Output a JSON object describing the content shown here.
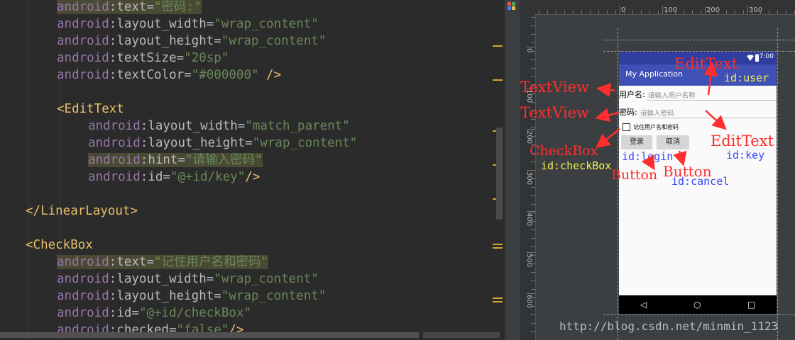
{
  "code_lines": [
    {
      "segments": [
        {
          "t": "android",
          "c": "ns hl"
        },
        {
          "t": ":",
          "c": "pun hl"
        },
        {
          "t": "text",
          "c": "attr hl"
        },
        {
          "t": "=",
          "c": "pun hl"
        },
        {
          "t": "\"密码:\"",
          "c": "str hl"
        }
      ],
      "indent": 80
    },
    {
      "segments": [
        {
          "t": "android",
          "c": "ns"
        },
        {
          "t": ":",
          "c": "pun"
        },
        {
          "t": "layout_width",
          "c": "attr"
        },
        {
          "t": "=",
          "c": "pun"
        },
        {
          "t": "\"wrap_content\"",
          "c": "str"
        }
      ],
      "indent": 80
    },
    {
      "segments": [
        {
          "t": "android",
          "c": "ns"
        },
        {
          "t": ":",
          "c": "pun"
        },
        {
          "t": "layout_height",
          "c": "attr"
        },
        {
          "t": "=",
          "c": "pun"
        },
        {
          "t": "\"wrap_content\"",
          "c": "str"
        }
      ],
      "indent": 80
    },
    {
      "segments": [
        {
          "t": "android",
          "c": "ns"
        },
        {
          "t": ":",
          "c": "pun"
        },
        {
          "t": "textSize",
          "c": "attr"
        },
        {
          "t": "=",
          "c": "pun"
        },
        {
          "t": "\"20sp\"",
          "c": "str"
        }
      ],
      "indent": 80
    },
    {
      "segments": [
        {
          "t": "android",
          "c": "ns"
        },
        {
          "t": ":",
          "c": "pun"
        },
        {
          "t": "textColor",
          "c": "attr"
        },
        {
          "t": "=",
          "c": "pun"
        },
        {
          "t": "\"#000000\"",
          "c": "str"
        },
        {
          "t": " />",
          "c": "tag"
        }
      ],
      "indent": 80
    },
    {
      "segments": [],
      "indent": 0
    },
    {
      "segments": [
        {
          "t": "<EditText",
          "c": "tag"
        }
      ],
      "indent": 80
    },
    {
      "segments": [
        {
          "t": "android",
          "c": "ns"
        },
        {
          "t": ":",
          "c": "pun"
        },
        {
          "t": "layout_width",
          "c": "attr"
        },
        {
          "t": "=",
          "c": "pun"
        },
        {
          "t": "\"match_parent\"",
          "c": "str"
        }
      ],
      "indent": 124
    },
    {
      "segments": [
        {
          "t": "android",
          "c": "ns"
        },
        {
          "t": ":",
          "c": "pun"
        },
        {
          "t": "layout_height",
          "c": "attr"
        },
        {
          "t": "=",
          "c": "pun"
        },
        {
          "t": "\"wrap_content\"",
          "c": "str"
        }
      ],
      "indent": 124
    },
    {
      "segments": [
        {
          "t": "android",
          "c": "ns hl"
        },
        {
          "t": ":",
          "c": "pun hl"
        },
        {
          "t": "hint",
          "c": "attr hl"
        },
        {
          "t": "=",
          "c": "pun hl"
        },
        {
          "t": "\"请输入密码\"",
          "c": "str hl"
        }
      ],
      "indent": 124
    },
    {
      "segments": [
        {
          "t": "android",
          "c": "ns"
        },
        {
          "t": ":",
          "c": "pun"
        },
        {
          "t": "id",
          "c": "attr"
        },
        {
          "t": "=",
          "c": "pun"
        },
        {
          "t": "\"@+id/key\"",
          "c": "str"
        },
        {
          "t": "/>",
          "c": "tag"
        }
      ],
      "indent": 124
    },
    {
      "segments": [],
      "indent": 0
    },
    {
      "segments": [
        {
          "t": "</LinearLayout>",
          "c": "tag"
        }
      ],
      "indent": 36
    },
    {
      "segments": [],
      "indent": 0
    },
    {
      "segments": [
        {
          "t": "<CheckBox",
          "c": "tag"
        }
      ],
      "indent": 36
    },
    {
      "segments": [
        {
          "t": "android",
          "c": "ns hl"
        },
        {
          "t": ":",
          "c": "pun hl"
        },
        {
          "t": "text",
          "c": "attr hl"
        },
        {
          "t": "=",
          "c": "pun hl"
        },
        {
          "t": "\"记住用户名和密码\"",
          "c": "str hl"
        }
      ],
      "indent": 80
    },
    {
      "segments": [
        {
          "t": "android",
          "c": "ns"
        },
        {
          "t": ":",
          "c": "pun"
        },
        {
          "t": "layout_width",
          "c": "attr"
        },
        {
          "t": "=",
          "c": "pun"
        },
        {
          "t": "\"wrap_content\"",
          "c": "str"
        }
      ],
      "indent": 80
    },
    {
      "segments": [
        {
          "t": "android",
          "c": "ns"
        },
        {
          "t": ":",
          "c": "pun"
        },
        {
          "t": "layout_height",
          "c": "attr"
        },
        {
          "t": "=",
          "c": "pun"
        },
        {
          "t": "\"wrap_content\"",
          "c": "str"
        }
      ],
      "indent": 80
    },
    {
      "segments": [
        {
          "t": "android",
          "c": "ns"
        },
        {
          "t": ":",
          "c": "pun"
        },
        {
          "t": "id",
          "c": "attr"
        },
        {
          "t": "=",
          "c": "pun"
        },
        {
          "t": "\"@+id/checkBox\"",
          "c": "str"
        }
      ],
      "indent": 80
    },
    {
      "segments": [
        {
          "t": "android",
          "c": "ns"
        },
        {
          "t": ":",
          "c": "pun"
        },
        {
          "t": "checked",
          "c": "attr"
        },
        {
          "t": "=",
          "c": "pun"
        },
        {
          "t": "\"false\"",
          "c": "str"
        },
        {
          "t": "/>",
          "c": "tag"
        }
      ],
      "indent": 80
    }
  ],
  "ruler": {
    "top_labels": [
      "0",
      "100",
      "200",
      "300"
    ],
    "left_labels": [
      "0",
      "100",
      "200",
      "300",
      "400",
      "500",
      "600"
    ]
  },
  "phone": {
    "status_time": "7:00",
    "app_title": "My Application",
    "username_label": "用户名:",
    "username_hint": "请输入用户名称",
    "password_label": "密码:",
    "password_hint": "请输入密码",
    "checkbox_label": "记住用户名和密码",
    "login_button": "登录",
    "cancel_button": "取消",
    "nav_back": "◁",
    "nav_home": "○",
    "nav_recent": "□"
  },
  "annotations": {
    "textview1": "TextView",
    "textview2": "TextView",
    "edittext1": "EditText",
    "edittext1_id": "id:user",
    "edittext2": "EditText",
    "edittext2_id": "id:key",
    "checkbox": "CheckBox",
    "checkbox_id": "id:checkBox",
    "login_id": "id:login",
    "button1": "Button",
    "button2": "Button",
    "cancel_id": "id:cancel"
  },
  "watermark": "http://blog.csdn.net/minmin_1123",
  "colors": {
    "editor_bg": "#2b2b2b",
    "status_bar": "#303f9f",
    "app_bar": "#3f51b5",
    "annotation_red": "#ff2d2d",
    "annotation_yellow": "#f3f34a",
    "annotation_blue": "#3b45ff"
  }
}
